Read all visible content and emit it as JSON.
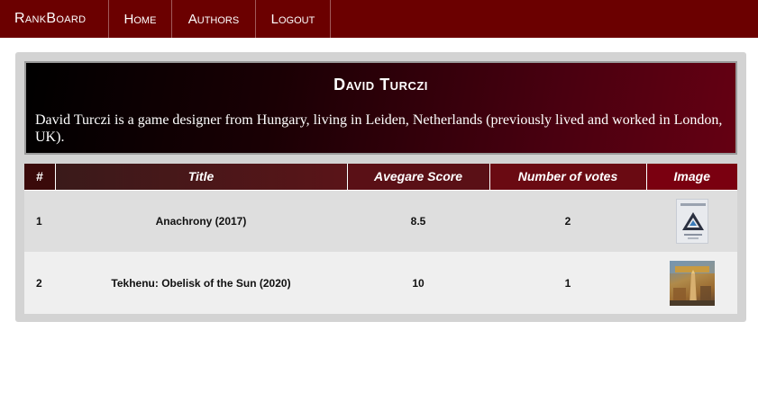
{
  "navbar": {
    "brand": "RankBoard",
    "items": [
      {
        "label": "Home"
      },
      {
        "label": "Authors"
      },
      {
        "label": "Logout"
      }
    ]
  },
  "author": {
    "name": "David Turczi",
    "bio": "David Turczi is a game designer from Hungary, living in Leiden, Netherlands (previously lived and worked in London, UK)."
  },
  "table": {
    "headers": {
      "rank": "#",
      "title": "Title",
      "avg": "Avegare Score",
      "votes": "Number of votes",
      "image": "Image"
    },
    "rows": [
      {
        "rank": "1",
        "title": "Anachrony (2017)",
        "avg": "8.5",
        "votes": "2",
        "image_icon": "anachrony-box-art-icon"
      },
      {
        "rank": "2",
        "title": "Tekhenu: Obelisk of the Sun (2020)",
        "avg": "10",
        "votes": "1",
        "image_icon": "tekhenu-box-art-icon"
      }
    ]
  },
  "colors": {
    "navbar_bg": "#6b0000",
    "panel_bg": "#d3d3d3",
    "row_odd": "#dedede",
    "row_even": "#efefef"
  }
}
